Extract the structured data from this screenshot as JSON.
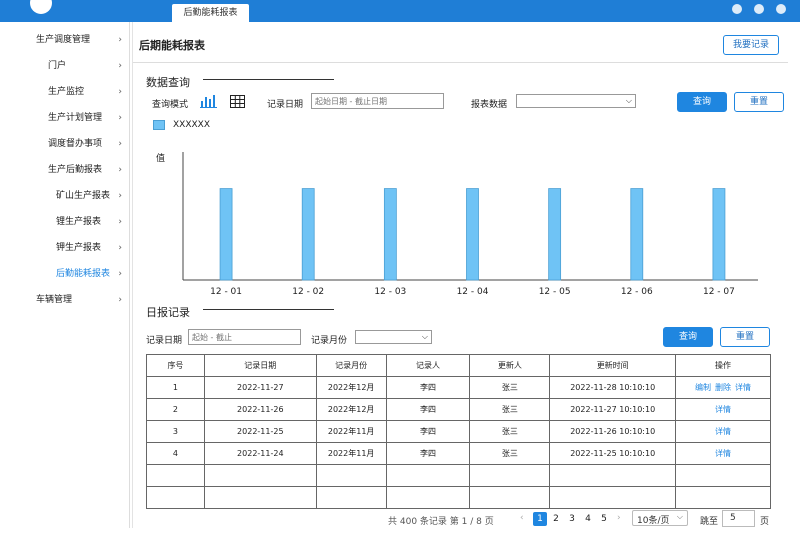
{
  "window": {
    "tab_title": "后勤能耗报表"
  },
  "sidebar": {
    "items": [
      {
        "label": "生产调度管理",
        "level": 0,
        "active": false
      },
      {
        "label": "门户",
        "level": 1,
        "active": false
      },
      {
        "label": "生产监控",
        "level": 1,
        "active": false
      },
      {
        "label": "生产计划管理",
        "level": 1,
        "active": false
      },
      {
        "label": "调度督办事项",
        "level": 1,
        "active": false
      },
      {
        "label": "生产后勤报表",
        "level": 1,
        "active": false
      },
      {
        "label": "矿山生产报表",
        "level": 2,
        "active": false
      },
      {
        "label": "锂生产报表",
        "level": 2,
        "active": false
      },
      {
        "label": "钾生产报表",
        "level": 2,
        "active": false
      },
      {
        "label": "后勤能耗报表",
        "level": 2,
        "active": true
      },
      {
        "label": "车辆管理",
        "level": 0,
        "active": false
      }
    ]
  },
  "header": {
    "title": "后期能耗报表",
    "my_record_button": "我要记录"
  },
  "query": {
    "section_title": "数据查询",
    "mode_label": "查询模式",
    "mode_icons": [
      "bar-chart-icon",
      "table-grid-icon"
    ],
    "date_label": "记录日期",
    "date_placeholder": "起始日期 - 截止日期",
    "report_label": "报表数据",
    "search_button": "查询",
    "reset_button": "重置"
  },
  "chart_data": {
    "type": "bar",
    "ylabel": "值",
    "categories": [
      "12 - 01",
      "12 - 02",
      "12 - 03",
      "12 - 04",
      "12 - 05",
      "12 - 06",
      "12 - 07"
    ],
    "series": [
      {
        "name": "XXXXXX",
        "values": [
          1,
          1,
          1,
          1,
          1,
          1,
          1
        ]
      }
    ],
    "ylim": [
      0,
      1.4
    ],
    "grid": false,
    "legend": "top-left",
    "bar_color": "#6fc3f5",
    "bar_border": "#4a9fd4"
  },
  "daily": {
    "section_title": "日报记录",
    "date_label": "记录日期",
    "date_placeholder": "起始 - 截止",
    "month_label": "记录月份",
    "search_button": "查询",
    "reset_button": "重置"
  },
  "table": {
    "headers": [
      "序号",
      "记录日期",
      "记录月份",
      "记录人",
      "更新人",
      "更新时间",
      "操作"
    ],
    "rows": [
      {
        "cells": [
          "1",
          "2022-11-27",
          "2022年12月",
          "李四",
          "张三",
          "2022-11-28 10:10:10"
        ],
        "actions": [
          "编制",
          "删除",
          "详情"
        ]
      },
      {
        "cells": [
          "2",
          "2022-11-26",
          "2022年12月",
          "李四",
          "张三",
          "2022-11-27 10:10:10"
        ],
        "actions": [
          "详情"
        ]
      },
      {
        "cells": [
          "3",
          "2022-11-25",
          "2022年11月",
          "李四",
          "张三",
          "2022-11-26 10:10:10"
        ],
        "actions": [
          "详情"
        ]
      },
      {
        "cells": [
          "4",
          "2022-11-24",
          "2022年11月",
          "李四",
          "张三",
          "2022-11-25 10:10:10"
        ],
        "actions": [
          "详情"
        ]
      },
      {
        "cells": [
          "",
          "",
          "",
          "",
          "",
          ""
        ],
        "actions": []
      },
      {
        "cells": [
          "",
          "",
          "",
          "",
          "",
          ""
        ],
        "actions": []
      }
    ]
  },
  "pagination": {
    "summary": "共 400 条记录 第 1 / 8 页",
    "prev": "‹",
    "next": "›",
    "pages": [
      "1",
      "2",
      "3",
      "4",
      "5"
    ],
    "current": "1",
    "page_size": "10条/页",
    "jump_label": "跳至",
    "jump_value": "5",
    "page_unit": "页"
  },
  "colors": {
    "accent": "#1f86e0",
    "topbar": "#1f7ed6"
  }
}
